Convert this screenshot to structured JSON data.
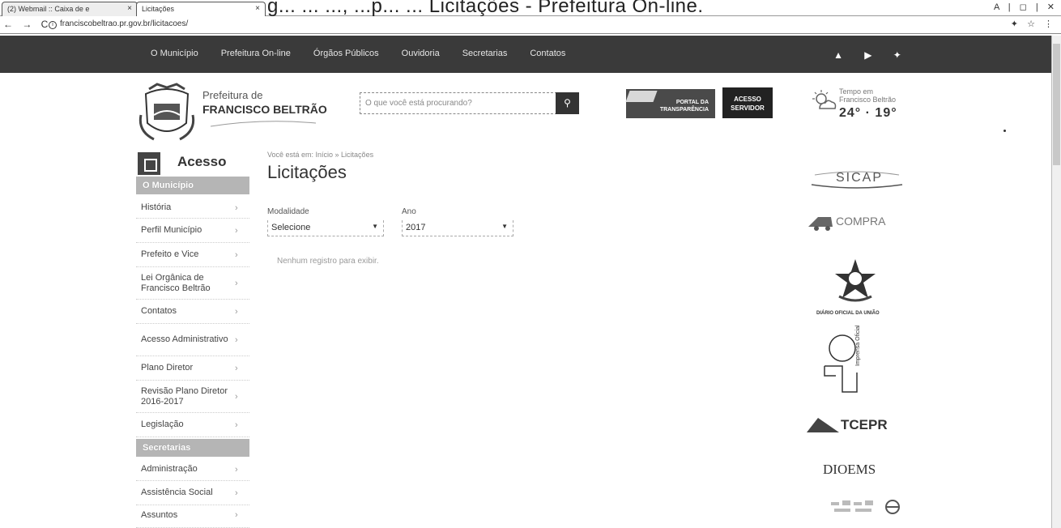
{
  "browser": {
    "tabs": [
      {
        "label": "(2) Webmail :: Caixa de e"
      },
      {
        "label": "Licitações"
      }
    ],
    "title_overlay": "g... ... ..., ...p... ... Licitações - Prefeitura On-line.",
    "url": "franciscobeltrao.pr.gov.br/licitacoes/",
    "window_controls": "A | ◻ | ✕"
  },
  "topnav": {
    "items": [
      "O Município",
      "Prefeitura On-line",
      "Órgãos Públicos",
      "Ouvidoria",
      "Secretarias",
      "Contatos"
    ],
    "social": [
      "▲",
      "▶",
      "✦"
    ]
  },
  "header": {
    "logo_line1": "Prefeitura de",
    "logo_line2": "FRANCISCO BELTRÃO",
    "search_placeholder": "O que você está procurando?",
    "portal_line1": "PORTAL DA",
    "portal_line2": "TRANSPARÊNCIA",
    "acesso_line1": "ACESSO",
    "acesso_line2": "SERVIDOR",
    "weather_line1": "Tempo em",
    "weather_line2": "Francisco Beltrão",
    "weather_temps": "24° · 19°"
  },
  "sidebar": {
    "title": "Acesso",
    "section1": "O Município",
    "items1": [
      {
        "label": "História"
      },
      {
        "label": "Perfil Município"
      },
      {
        "label": "Prefeito e Vice"
      },
      {
        "label": "Lei Orgânica de Francisco Beltrão"
      },
      {
        "label": "Contatos"
      },
      {
        "label": "Acesso Administrativo"
      },
      {
        "label": "Plano Diretor"
      },
      {
        "label": "Revisão Plano Diretor 2016-2017"
      },
      {
        "label": "Legislação"
      }
    ],
    "section2": "Secretarias",
    "items2": [
      {
        "label": "Administração"
      },
      {
        "label": "Assistência Social"
      },
      {
        "label": "Assuntos"
      }
    ]
  },
  "main": {
    "breadcrumb": "Você está em: Início » Licitações",
    "title": "Licitações",
    "modalidade_label": "Modalidade",
    "modalidade_value": "Selecione",
    "ano_label": "Ano",
    "ano_value": "2017",
    "hint": "Nenhum registro para exibir."
  },
  "right_logos": {
    "sicap": "SICAP",
    "compra": "COMPRA",
    "diario": "DIÁRIO OFICIAL DA UNIÃO",
    "imprensa": "Imprensa Oficial",
    "tcepr": "TCEPR",
    "diioems": "DIOEMS"
  }
}
